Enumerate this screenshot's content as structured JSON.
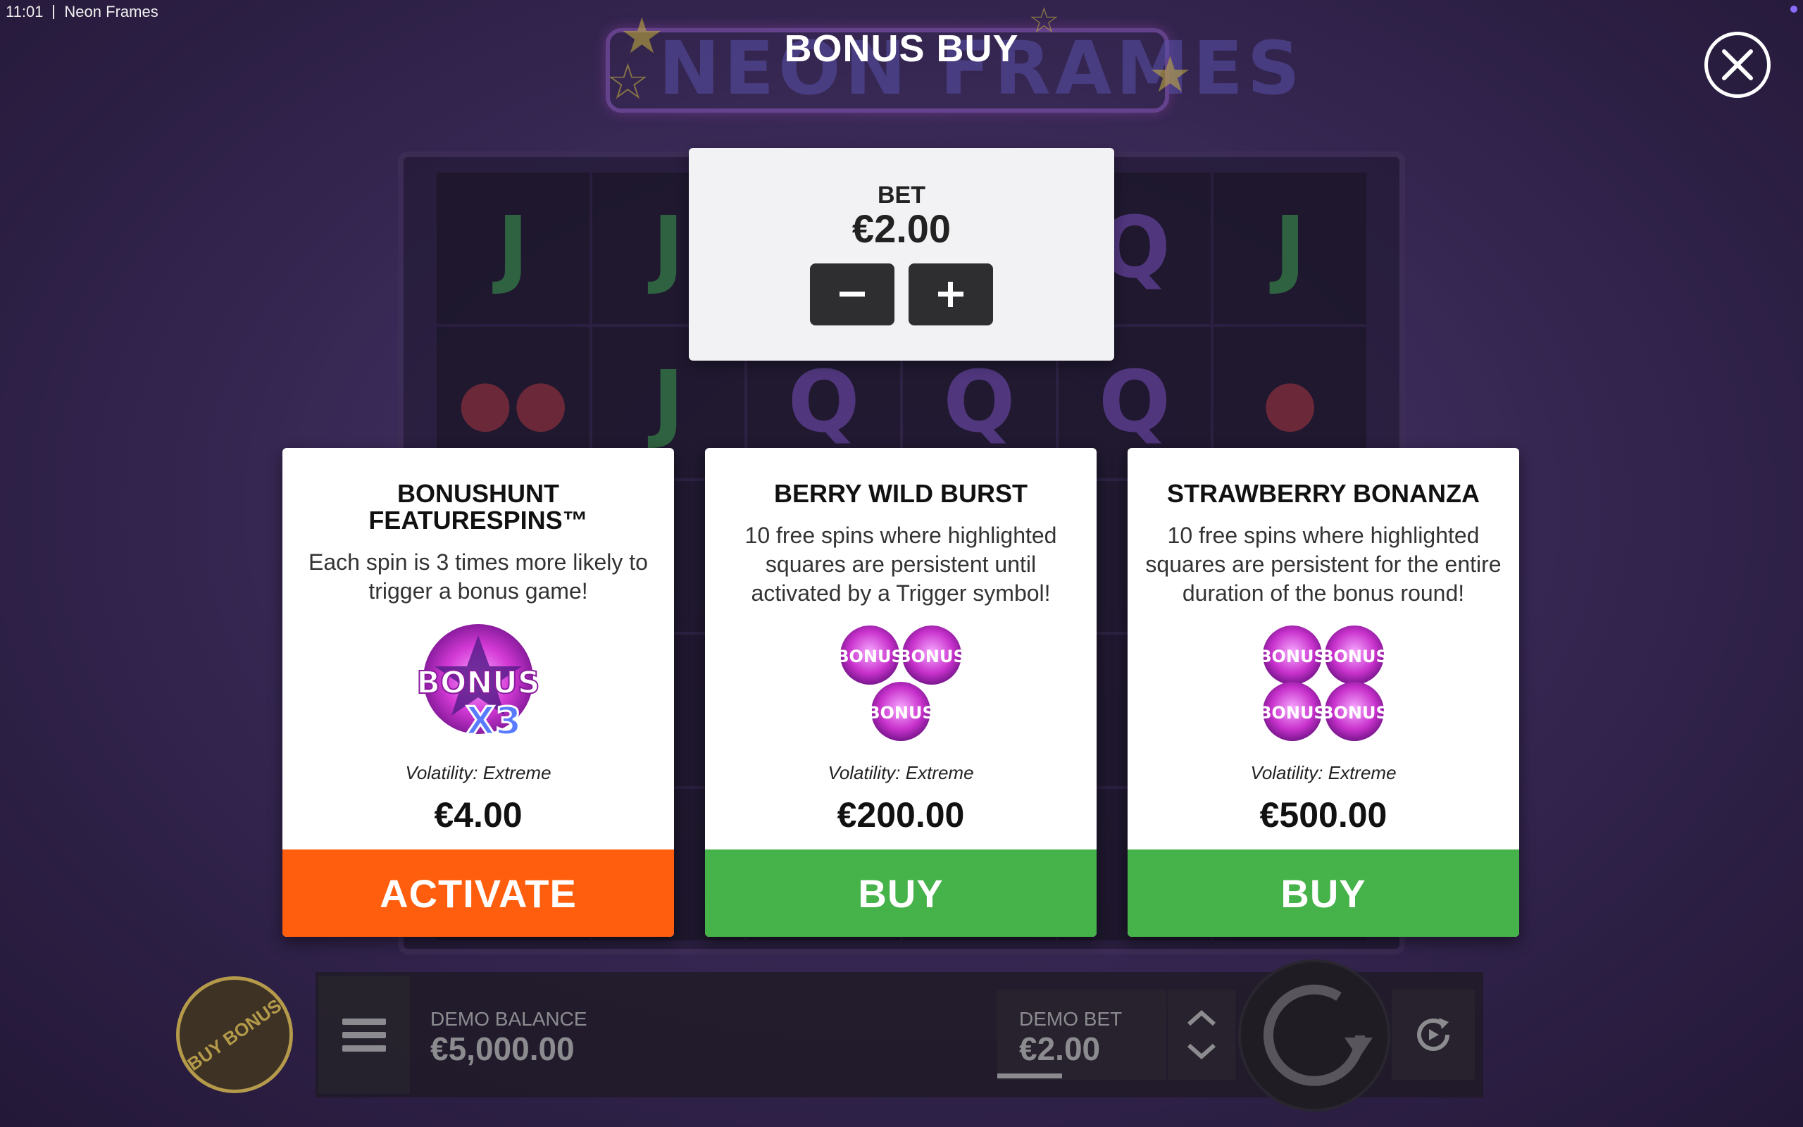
{
  "system": {
    "time": "11:01",
    "app_name": "Neon Frames"
  },
  "background": {
    "logo_text": "NEON FRAMES"
  },
  "header": {
    "title": "BONUS BUY"
  },
  "bet_panel": {
    "label": "BET",
    "value": "€2.00"
  },
  "cards": [
    {
      "title": "BONUSHUNT FEATURESPINS™",
      "description": "Each spin is 3 times more likely to trigger a bonus game!",
      "icon_text": "BONUS",
      "icon_multiplier": "X3",
      "volatility": "Volatility: Extreme",
      "price": "€4.00",
      "button_label": "ACTIVATE",
      "button_color": "#ff5e0e"
    },
    {
      "title": "BERRY WILD BURST",
      "description": "10 free spins where highlighted squares are persistent until activated by a Trigger symbol!",
      "icon_text": "BONUS",
      "icon_count": 3,
      "volatility": "Volatility: Extreme",
      "price": "€200.00",
      "button_label": "BUY",
      "button_color": "#45b24a"
    },
    {
      "title": "STRAWBERRY BONANZA",
      "description": "10 free spins where highlighted squares are persistent for the entire duration of the bonus round!",
      "icon_text": "BONUS",
      "icon_count": 4,
      "volatility": "Volatility: Extreme",
      "price": "€500.00",
      "button_label": "BUY",
      "button_color": "#45b24a"
    }
  ],
  "bottom_bar": {
    "buy_bonus_label": "BUY BONUS",
    "balance_label": "DEMO BALANCE",
    "balance_value": "€5,000.00",
    "bet_label": "DEMO BET",
    "bet_value": "€2.00"
  }
}
